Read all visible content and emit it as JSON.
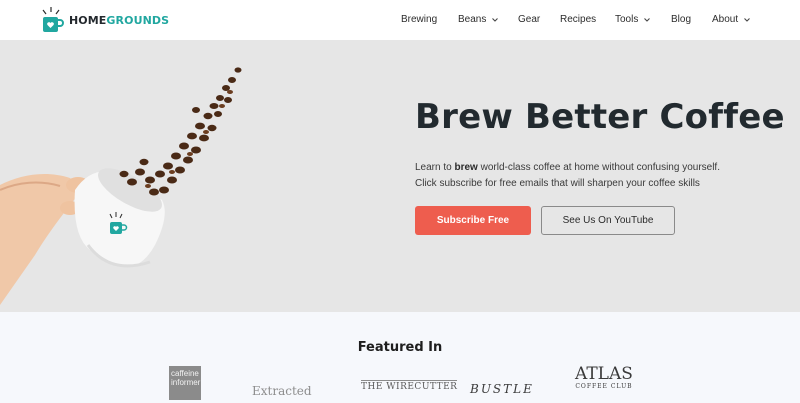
{
  "header": {
    "logo": {
      "part1": "HOME",
      "part2": "GROUNDS"
    },
    "nav": [
      {
        "label": "Brewing",
        "dropdown": false
      },
      {
        "label": "Beans",
        "dropdown": true
      },
      {
        "label": "Gear",
        "dropdown": false
      },
      {
        "label": "Recipes",
        "dropdown": false
      },
      {
        "label": "Tools",
        "dropdown": true
      },
      {
        "label": "Blog",
        "dropdown": false
      },
      {
        "label": "About",
        "dropdown": true
      }
    ]
  },
  "hero": {
    "title": "Brew Better Coffee",
    "desc_prefix": "Learn to ",
    "desc_bold": "brew",
    "desc_rest": " world-class coffee at home without confusing yourself.",
    "desc_line2": "Click subscribe for free emails that will sharpen your coffee skills",
    "primary_button": "Subscribe Free",
    "secondary_button": "See Us On YouTube"
  },
  "featured": {
    "title": "Featured In",
    "brands": {
      "caffeine_1": "caffeine",
      "caffeine_2": "informer",
      "extracted": "Extracted",
      "wirecutter": "THE WIRECUTTER",
      "bustle": "BUSTLE",
      "atlas": "ATLAS",
      "atlas_sub": "COFFEE CLUB"
    }
  },
  "colors": {
    "accent_teal": "#21a7a0",
    "primary_button": "#ee5d4e",
    "hero_bg": "#e6e6e6",
    "featured_bg": "#f6f8fc"
  }
}
